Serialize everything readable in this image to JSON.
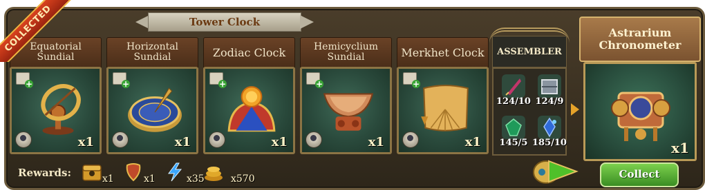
{
  "title": "Tower Clock",
  "collected_label": "COLLECTED",
  "items": [
    {
      "name": "Equatorial Sundial",
      "quantity": "x1"
    },
    {
      "name": "Horizontal Sundial",
      "quantity": "x1"
    },
    {
      "name": "Zodiac Clock",
      "quantity": "x1"
    },
    {
      "name": "Hemicyclium Sundial",
      "quantity": "x1"
    },
    {
      "name": "Merkhet Clock",
      "quantity": "x1"
    }
  ],
  "assembler": {
    "title": "ASSEMBLER",
    "materials": [
      {
        "icon": "quill-icon",
        "count": "124/10"
      },
      {
        "icon": "crate-icon",
        "count": "124/9"
      },
      {
        "icon": "emerald-icon",
        "count": "145/5"
      },
      {
        "icon": "blue-crystal-icon",
        "count": "185/10"
      }
    ]
  },
  "result": {
    "name": "Astrarium Chronometer",
    "quantity": "x1",
    "collect_label": "Collect"
  },
  "rewards": {
    "label": "Rewards:",
    "items": [
      {
        "icon": "mystery-chest-icon",
        "count": "x1"
      },
      {
        "icon": "amulet-icon",
        "count": "x1"
      },
      {
        "icon": "energy-bolt-icon",
        "count": "x35"
      },
      {
        "icon": "gold-coins-icon",
        "count": "x570"
      }
    ]
  },
  "colors": {
    "panel": "#3a3122",
    "card_label": "#5b3820",
    "slot_green": "#2a4a3c",
    "gold_border": "#8c7444",
    "collect_green": "#5aae36",
    "collected_red": "#c23a1a"
  }
}
